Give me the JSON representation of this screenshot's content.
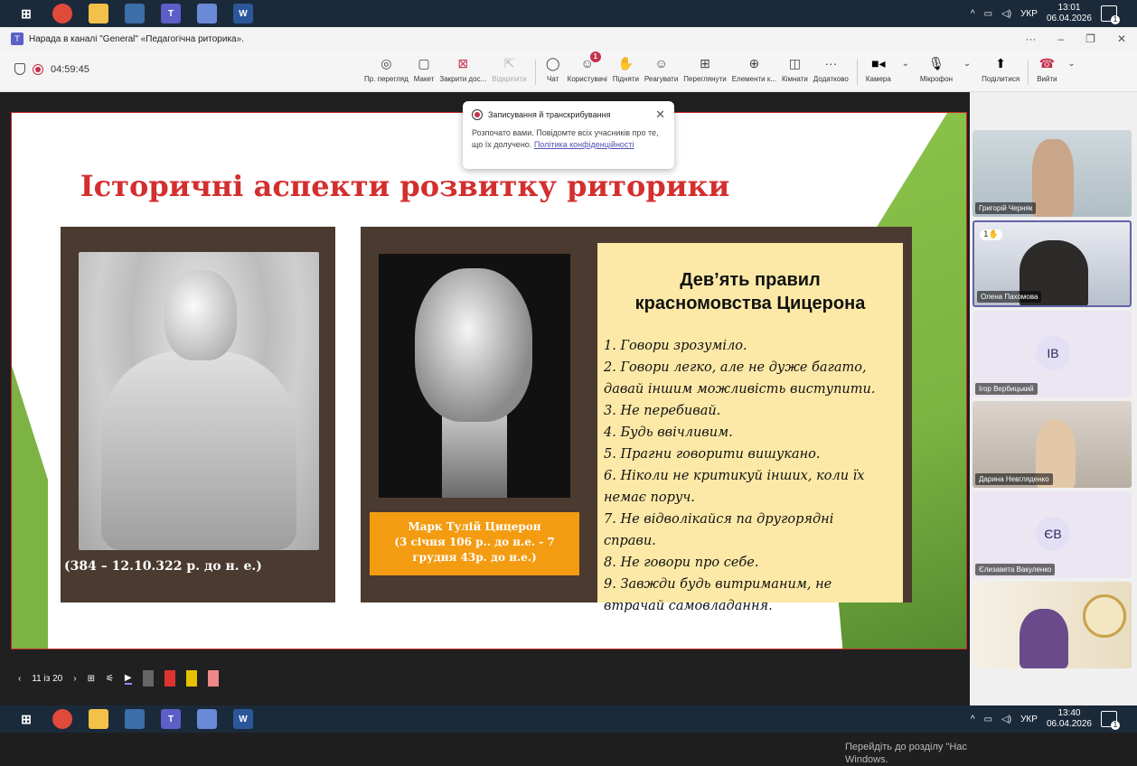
{
  "taskbar_top": {
    "clock_time": "13:01",
    "clock_date": "06.04.2026",
    "lang": "УКР",
    "notif_count": "1"
  },
  "taskbar_bottom": {
    "clock_time": "13:40",
    "clock_date": "06.04.2026",
    "lang": "УКР",
    "notif_count": "1"
  },
  "window": {
    "title": "Нарада в каналі \"General\" «Педагогічна риторика»."
  },
  "meeting": {
    "timer": "04:59:45",
    "tools": [
      {
        "label": "Пр. перегляд",
        "icon": "eye-icon"
      },
      {
        "label": "Макет",
        "icon": "layout-icon"
      },
      {
        "label": "Закрити дос...",
        "icon": "close-share-icon"
      },
      {
        "label": "Відкріпити",
        "icon": "unpin-icon",
        "disabled": true
      },
      {
        "label": "Чат",
        "icon": "chat-icon"
      },
      {
        "label": "Користувачі",
        "icon": "people-icon",
        "badge": "1"
      },
      {
        "label": "Підняти",
        "icon": "raise-hand-icon"
      },
      {
        "label": "Реагувати",
        "icon": "react-icon"
      },
      {
        "label": "Переглянути",
        "icon": "view-icon"
      },
      {
        "label": "Елементи к...",
        "icon": "apps-icon"
      },
      {
        "label": "Кімнати",
        "icon": "rooms-icon"
      },
      {
        "label": "Додатково",
        "icon": "more-icon"
      },
      {
        "label": "Камера",
        "icon": "camera-icon"
      },
      {
        "label": "Мікрофон",
        "icon": "mic-icon"
      },
      {
        "label": "Поділитися",
        "icon": "share-icon"
      },
      {
        "label": "Вийти",
        "icon": "leave-icon"
      }
    ]
  },
  "popup": {
    "title": "Записування й транскрибування",
    "body": "Розпочато вами. Повідомте всіх учасників про те, що їх долучено.",
    "link": "Політика конфіденційності"
  },
  "slide": {
    "title": "Історичні аспекти розвитку риторики",
    "dates_left": "(384 – 12.10.322 р. до н. е.)",
    "caption_cicero_line1": "Марк Тулій Цицерон",
    "caption_cicero_line2": "(3 січня 106 р.. до н.е. - 7",
    "caption_cicero_line3": "грудня 43р. до н.е.)",
    "rules_title_1": "Дев’ять правил",
    "rules_title_2": "красномовства Цицерона",
    "rules": [
      "1. Говори зрозуміло.",
      "2. Говори легко, але не дуже багато,",
      "давай іншим можливість виступити.",
      "3. Не перебивай.",
      "4. Будь ввічливим.",
      "5. Прагни говорити вишукано.",
      "6. Ніколи не критикуй інших, коли їх",
      "немає поруч.",
      "7. Не відволікайся па другорядні",
      "справи.",
      "8. Не говори про себе.",
      "9. Завжди будь витриманим, не",
      "втрачай самовладання."
    ]
  },
  "slide_controls": {
    "page": "11 із 20"
  },
  "watermark": {
    "line1": "Перейдіть до розділу \"Нас",
    "line2": "Windows."
  },
  "participants": [
    {
      "name": "Григорій Черняк",
      "muted": true
    },
    {
      "name": "Олена Пахомова",
      "hand": "1"
    },
    {
      "name": "Ігор Вербицький",
      "initials": "ІВ",
      "muted": true
    },
    {
      "name": "Дарина Невгляденко"
    },
    {
      "name": "Єлизавета Вакуленко",
      "initials": "ЄВ",
      "muted": true
    },
    {
      "name": ""
    }
  ]
}
